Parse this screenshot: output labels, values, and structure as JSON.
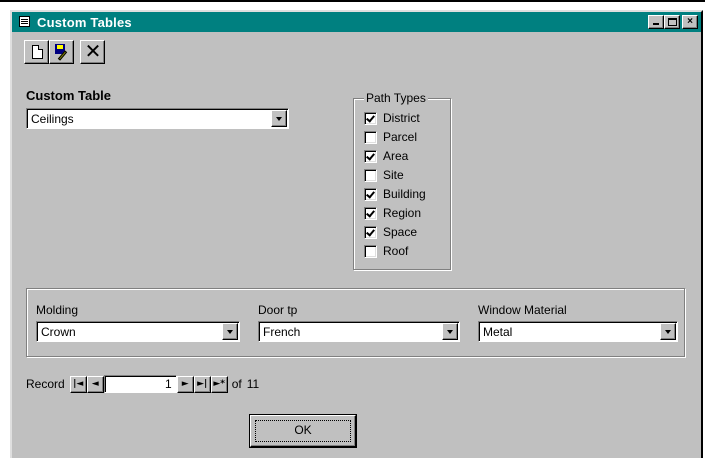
{
  "window": {
    "title": "Custom Tables",
    "controls": {
      "minimize": "_",
      "maximize": "□",
      "close": "×"
    }
  },
  "toolbar": {
    "items": [
      {
        "name": "new-record",
        "icon": "new-document-icon"
      },
      {
        "name": "edit-record",
        "icon": "disk-pencil-icon"
      },
      {
        "name": "delete-record",
        "icon": "x-icon",
        "glyph": "✕"
      }
    ]
  },
  "custom_table": {
    "label": "Custom Table",
    "value": "Ceilings"
  },
  "path_types": {
    "legend": "Path Types",
    "items": [
      {
        "label": "District",
        "checked": true
      },
      {
        "label": "Parcel",
        "checked": false
      },
      {
        "label": "Area",
        "checked": true
      },
      {
        "label": "Site",
        "checked": false
      },
      {
        "label": "Building",
        "checked": true
      },
      {
        "label": "Region",
        "checked": true
      },
      {
        "label": "Space",
        "checked": true
      },
      {
        "label": "Roof",
        "checked": false
      }
    ]
  },
  "fields": {
    "molding": {
      "label": "Molding",
      "value": "Crown"
    },
    "door": {
      "label": "Door tp",
      "value": "French"
    },
    "window_material": {
      "label": "Window Material",
      "value": "Metal"
    }
  },
  "navigator": {
    "label": "Record",
    "current": "1",
    "of_label": "of",
    "total": "11",
    "buttons": {
      "first": "|◄",
      "prev": "◄",
      "next": "►",
      "last": "►|",
      "new": "►*"
    }
  },
  "ok_button": {
    "label": "OK"
  },
  "colors": {
    "titlebar": "#008080",
    "face": "#c0c0c0"
  }
}
